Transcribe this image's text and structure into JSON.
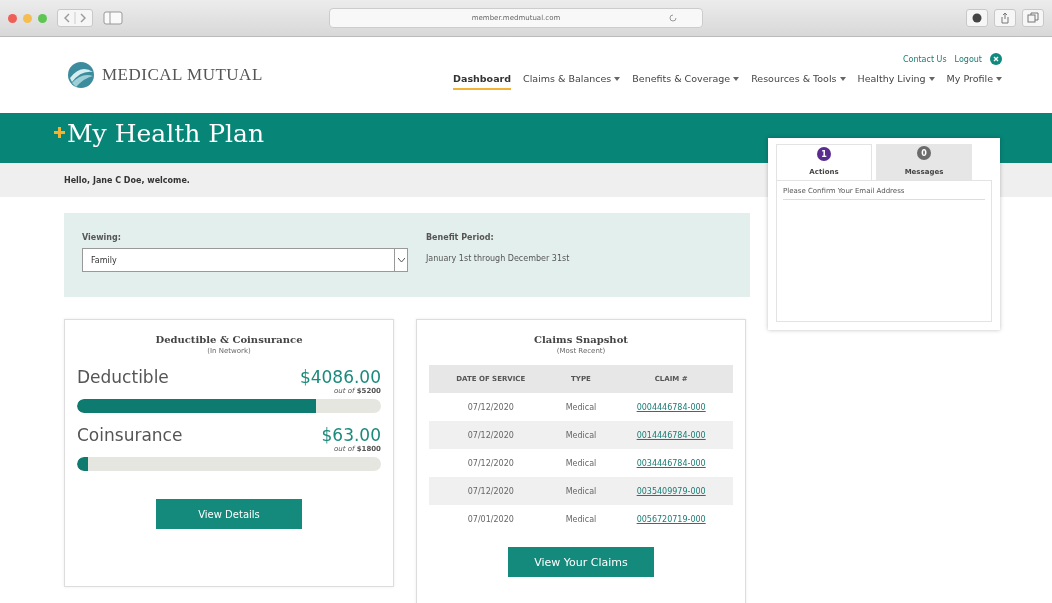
{
  "browser": {
    "url": "member.medmutual.com"
  },
  "header": {
    "logo": "MEDICAL MUTUAL",
    "links": [
      {
        "label": "Contact Us"
      },
      {
        "label": "Logout"
      }
    ],
    "nav": [
      {
        "label": "Dashboard",
        "selected": true,
        "dropdown": false
      },
      {
        "label": "Claims & Balances",
        "selected": false,
        "dropdown": true
      },
      {
        "label": "Benefits & Coverage",
        "selected": false,
        "dropdown": true
      },
      {
        "label": "Resources & Tools",
        "selected": false,
        "dropdown": true
      },
      {
        "label": "Healthy Living",
        "selected": false,
        "dropdown": true
      },
      {
        "label": "My Profile",
        "selected": false,
        "dropdown": true
      }
    ]
  },
  "banner": {
    "title": "My Health Plan"
  },
  "welcome": "Hello, Jane C Doe, welcome.",
  "plan": {
    "viewing_label": "Viewing:",
    "viewing_value": "Family",
    "period_label": "Benefit Period:",
    "period_value": "January 1st through December 31st"
  },
  "deductible_card": {
    "title": "Deductible & Coinsurance",
    "subtitle": "(In Network)",
    "meters": [
      {
        "name": "Deductible",
        "amount": "$4086.00",
        "out_of": "out of",
        "limit": "$5200",
        "level": 0.786
      },
      {
        "name": "Coinsurance",
        "amount": "$63.00",
        "out_of": "out of",
        "limit": "$1800",
        "level": 0.035
      }
    ],
    "button": "View Details"
  },
  "claims_card": {
    "title": "Claims Snapshot",
    "subtitle": "(Most Recent)",
    "columns": [
      "DATE OF SERVICE",
      "TYPE",
      "CLAIM #"
    ],
    "rows": [
      [
        "07/12/2020",
        "Medical",
        "0004446784-000"
      ],
      [
        "07/12/2020",
        "Medical",
        "0014446784-000"
      ],
      [
        "07/12/2020",
        "Medical",
        "0034446784-000"
      ],
      [
        "07/12/2020",
        "Medical",
        "0035409979-000"
      ],
      [
        "07/01/2020",
        "Medical",
        "0056720719-000"
      ]
    ],
    "button": "View Your Claims"
  },
  "alerts": {
    "tabs": [
      {
        "label": "Actions",
        "count": "1",
        "color": "#5b2c8f",
        "selected": true
      },
      {
        "label": "Messages",
        "count": "0",
        "color": "#6b6b6b",
        "selected": false
      }
    ],
    "items": [
      "Please Confirm Your Email Address"
    ]
  }
}
